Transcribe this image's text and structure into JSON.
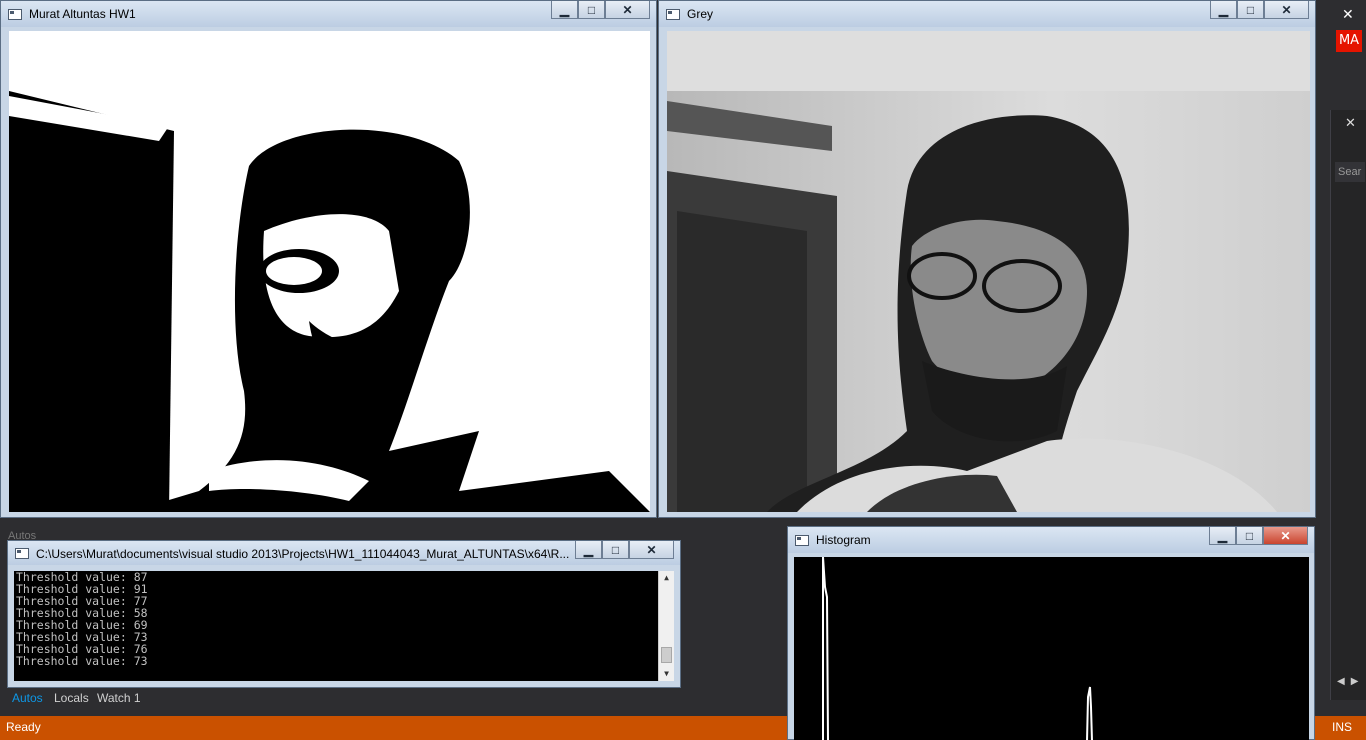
{
  "vs": {
    "account_badge": "MA",
    "search_placeholder": "Sear",
    "status": "Ready",
    "ins": "INS",
    "autos_ghost": "Autos",
    "tabs": [
      {
        "label": "Autos",
        "active": true
      },
      {
        "label": "Locals",
        "active": false
      },
      {
        "label": "Watch 1",
        "active": false
      }
    ]
  },
  "windows": {
    "threshold": {
      "title": "Murat Altuntas HW1"
    },
    "grey": {
      "title": "Grey"
    },
    "console": {
      "title": "C:\\Users\\Murat\\documents\\visual studio 2013\\Projects\\HW1_111044043_Murat_ALTUNTAS\\x64\\R...",
      "lines": [
        "Threshold value: 87",
        "Threshold value: 91",
        "Threshold value: 77",
        "Threshold value: 58",
        "Threshold value: 69",
        "Threshold value: 73",
        "Threshold value: 76",
        "Threshold value: 73"
      ]
    },
    "histogram": {
      "title": "Histogram"
    }
  },
  "controls": {
    "minimize": "▁",
    "maximize": "□",
    "close": "✕"
  },
  "colors": {
    "status_bar": "#ca5100",
    "accent": "#007acc",
    "badge": "#e51400"
  }
}
